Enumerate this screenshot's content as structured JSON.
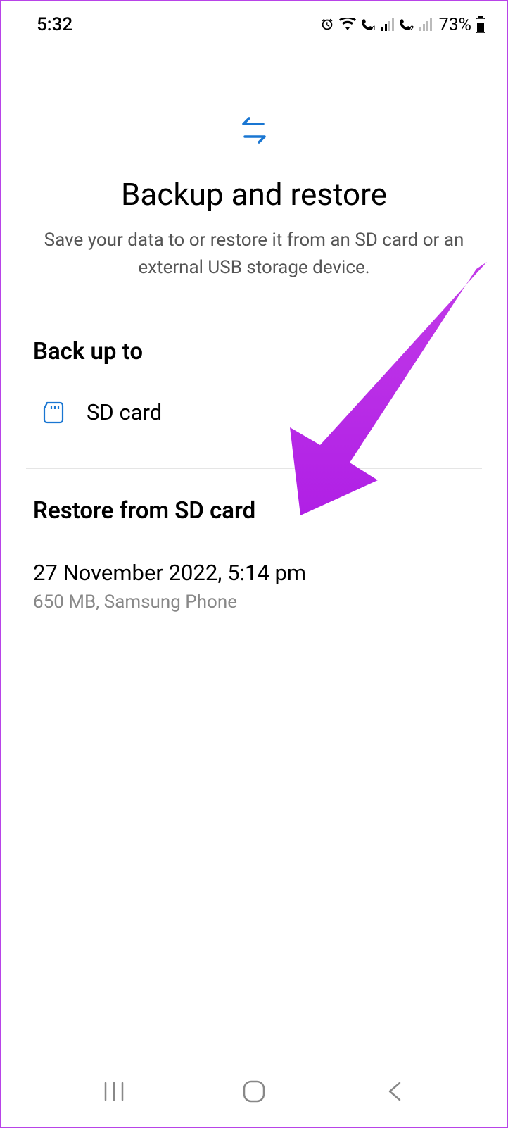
{
  "status_bar": {
    "time": "5:32",
    "battery_percent": "73%"
  },
  "header": {
    "title": "Backup and restore",
    "subtitle": "Save your data to or restore it from an SD card or an external USB storage device."
  },
  "backup_section": {
    "header": "Back up to",
    "item_label": "SD card"
  },
  "restore_section": {
    "header": "Restore from SD card",
    "backup": {
      "date": "27 November 2022, 5:14 pm",
      "meta": "650 MB, Samsung Phone"
    }
  }
}
